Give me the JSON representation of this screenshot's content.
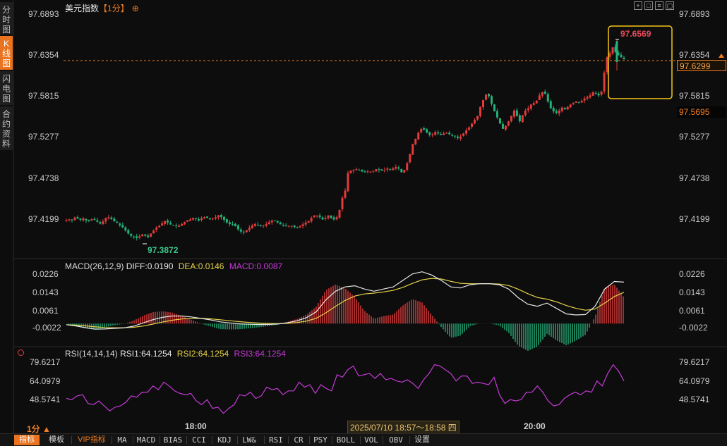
{
  "left_tabs": [
    {
      "label": "分时图",
      "active": false
    },
    {
      "label": "K线图",
      "active": true
    },
    {
      "label": "闪电图",
      "active": false
    },
    {
      "label": "合约资料",
      "active": false
    }
  ],
  "title": {
    "name": "美元指数",
    "period": "【1分】",
    "plus": "⊕"
  },
  "toolbar_icons": [
    "crosshair-icon",
    "zoom-icon",
    "chart-type-icon",
    "window-icon"
  ],
  "price_axis": {
    "ticks": [
      "97.6893",
      "97.6354",
      "97.5815",
      "97.5277",
      "97.4738",
      "97.4199"
    ],
    "last_price": "97.6299",
    "low_marker": "97.5695",
    "high_label": "97.6569",
    "low_label": "97.3872"
  },
  "macd": {
    "header": "MACD(26,12,9)",
    "diff": "DIFF:0.0190",
    "dea": "DEA:0.0146",
    "macd": "MACD:0.0087",
    "ticks": [
      "0.0226",
      "0.0143",
      "0.0061",
      "-0.0022"
    ]
  },
  "rsi": {
    "header": "RSI(14,14,14)",
    "rsi1": "RSI1:64.1254",
    "rsi2": "RSI2:64.1254",
    "rsi3": "RSI3:64.1254",
    "ticks": [
      "79.6217",
      "64.0979",
      "48.5741"
    ]
  },
  "time_axis": {
    "t1": "18:00",
    "t2": "20:00",
    "range": "2025/07/10 18:57～18:58 四",
    "period": "1分 ▲"
  },
  "bottom_tabs": [
    "指标",
    "模板",
    "VIP指标",
    "MA",
    "MACD",
    "BIAS",
    "CCI",
    "KDJ",
    "LW&",
    "RSI",
    "CR",
    "PSY",
    "BOLL",
    "VOL",
    "OBV",
    "设置"
  ],
  "colors": {
    "up": "#e23b3b",
    "down": "#23b07a",
    "accent": "#f07d22",
    "highlight_box": "#f5c518",
    "diff": "#e8e8e8",
    "dea": "#e6d34a",
    "rsi": "#c43ad6",
    "last": "#f07d22"
  },
  "chart_data": {
    "type": "candlestick",
    "ylim": [
      97.3872,
      97.6893
    ],
    "close_path": [
      97.419,
      97.4195,
      97.4185,
      97.422,
      97.4205,
      97.419,
      97.421,
      97.418,
      97.4175,
      97.42,
      97.419,
      97.4165,
      97.414,
      97.417,
      97.4215,
      97.4225,
      97.42,
      97.417,
      97.415,
      97.412,
      97.409,
      97.405,
      97.401,
      97.398,
      97.3965,
      97.395,
      97.3975,
      97.4,
      97.398,
      97.396,
      97.401,
      97.405,
      97.409,
      97.411,
      97.4145,
      97.4175,
      97.4155,
      97.413,
      97.4115,
      97.4105,
      97.4115,
      97.4135,
      97.416,
      97.4185,
      97.4195,
      97.4215,
      97.42,
      97.418,
      97.421,
      97.4225,
      97.4215,
      97.4195,
      97.4205,
      97.4225,
      97.425,
      97.4225,
      97.419,
      97.4155,
      97.4135,
      97.413,
      97.4105,
      97.4065,
      97.4035,
      97.4025,
      97.4055,
      97.4085,
      97.4115,
      97.4135,
      97.4125,
      97.4105,
      97.4115,
      97.4135,
      97.416,
      97.418,
      97.4175,
      97.4155,
      97.413,
      97.4115,
      97.4105,
      97.411,
      97.411,
      97.4095,
      97.4085,
      97.4105,
      97.413,
      97.4155,
      97.4175,
      97.4215,
      97.4245,
      97.4245,
      97.4225,
      97.4195,
      97.4215,
      97.4245,
      97.4215,
      97.4195,
      97.4225,
      97.432,
      97.448,
      97.4575,
      97.4805,
      97.4835,
      97.4845,
      97.4855,
      97.4845,
      97.4825,
      97.4815,
      97.4825,
      97.4825,
      97.4835,
      97.4855,
      97.4845,
      97.4835,
      97.4845,
      97.4865,
      97.4855,
      97.4865,
      97.4885,
      97.4865,
      97.4815,
      97.4845,
      97.4935,
      97.5055,
      97.5185,
      97.5255,
      97.5335,
      97.5385,
      97.5375,
      97.5335,
      97.5305,
      97.5315,
      97.5345,
      97.5325,
      97.5305,
      97.5325,
      97.5335,
      97.5315,
      97.5295,
      97.5285,
      97.5265,
      97.5285,
      97.5325,
      97.5365,
      97.5405,
      97.5455,
      97.5505,
      97.5555,
      97.5675,
      97.5765,
      97.5835,
      97.5815,
      97.5715,
      97.5615,
      97.5535,
      97.5455,
      97.5385,
      97.5425,
      97.5485,
      97.5555,
      97.5625,
      97.5555,
      97.5485,
      97.5565,
      97.5625,
      97.5655,
      97.5705,
      97.5725,
      97.5755,
      97.5825,
      97.5865,
      97.5845,
      97.5745,
      97.5655,
      97.5615,
      97.5595,
      97.5625,
      97.5665,
      97.5645,
      97.5675,
      97.5705,
      97.5725,
      97.5745,
      97.5735,
      97.5755,
      97.5785,
      97.5805,
      97.5825,
      97.5865,
      97.5855,
      97.5825,
      97.5875,
      97.6125,
      97.6325,
      97.6385,
      97.6455,
      97.6395,
      97.6355,
      97.6325,
      97.6299
    ],
    "macd_diff_path": [
      -0.0005,
      -0.0011,
      -0.0019,
      -0.0026,
      -0.0025,
      -0.0022,
      -0.002,
      -0.0012,
      0.0003,
      0.0018,
      0.0029,
      0.0035,
      0.0035,
      0.0031,
      0.0024,
      0.0017,
      0.0008,
      0.0003,
      -0.0001,
      -0.0003,
      -0.0004,
      -0.0004,
      -0.0002,
      0.0004,
      0.0013,
      0.0028,
      0.0055,
      0.011,
      0.015,
      0.017,
      0.0175,
      0.016,
      0.015,
      0.016,
      0.017,
      0.02,
      0.023,
      0.024,
      0.0225,
      0.02,
      0.017,
      0.0165,
      0.018,
      0.0185,
      0.0185,
      0.018,
      0.016,
      0.012,
      0.009,
      0.008,
      0.0095,
      0.007,
      0.0045,
      0.004,
      0.0042,
      0.008,
      0.016,
      0.0195,
      0.0192
    ],
    "rsi_path": [
      50,
      49,
      52,
      53,
      46,
      45,
      48,
      44,
      40,
      43,
      44,
      47,
      52,
      51,
      55,
      55,
      60,
      57,
      63,
      60,
      56,
      54,
      53,
      54,
      48,
      45,
      49,
      42,
      43,
      38,
      42,
      45,
      53,
      52,
      55,
      50,
      52,
      59,
      57,
      58,
      53,
      56,
      56,
      63,
      59,
      61,
      54,
      61,
      58,
      56,
      69,
      67,
      73,
      76,
      68,
      69,
      70,
      66,
      70,
      65,
      66,
      64,
      63,
      65,
      62,
      58,
      65,
      70,
      77,
      76,
      73,
      70,
      64,
      68,
      68,
      62,
      63,
      62,
      61,
      67,
      53,
      46,
      49,
      48,
      49,
      55,
      55,
      60,
      55,
      48,
      44,
      45,
      50,
      53,
      55,
      53,
      56,
      55,
      64,
      60,
      70,
      77,
      72,
      64
    ]
  }
}
